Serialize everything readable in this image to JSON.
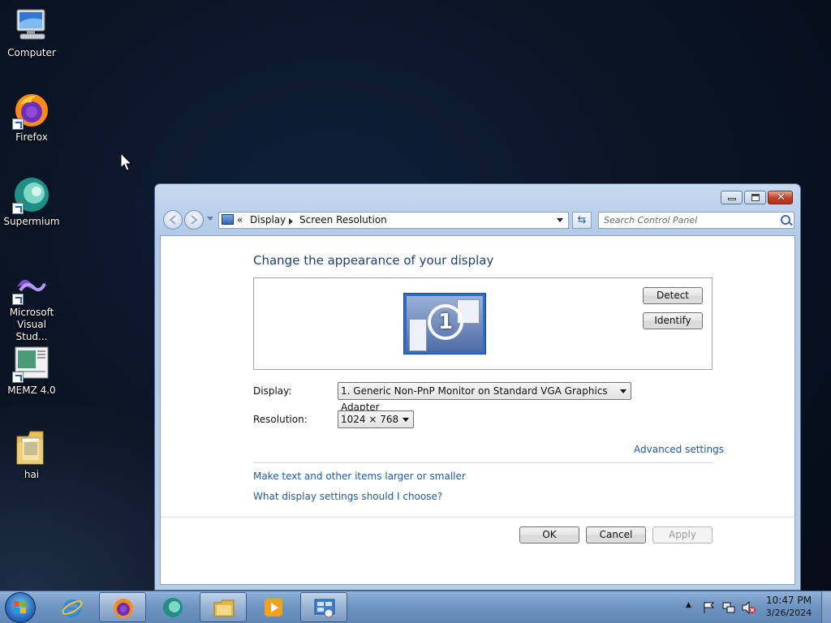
{
  "desktop": {
    "icons": [
      {
        "label": "Computer",
        "icon": "computer-icon"
      },
      {
        "label": "Firefox",
        "icon": "firefox-icon"
      },
      {
        "label": "Supermium",
        "icon": "supermium-icon"
      },
      {
        "label": "Microsoft Visual Stud...",
        "icon": "visual-studio-icon"
      },
      {
        "label": "MEMZ 4.0",
        "icon": "memz-icon"
      },
      {
        "label": "hai",
        "icon": "folder-icon"
      }
    ]
  },
  "window": {
    "breadcrumb": {
      "overflow": "«",
      "items": [
        "Display",
        "Screen Resolution"
      ]
    },
    "search_placeholder": "Search Control Panel",
    "page_title": "Change the appearance of your display",
    "monitor_number": "1",
    "detect_label": "Detect",
    "identify_label": "Identify",
    "display_label": "Display:",
    "display_value": "1. Generic Non-PnP Monitor on Standard VGA Graphics Adapter",
    "resolution_label": "Resolution:",
    "resolution_value": "1024 × 768",
    "advanced_link": "Advanced settings",
    "links": [
      "Make text and other items larger or smaller",
      "What display settings should I choose?"
    ],
    "ok_label": "OK",
    "cancel_label": "Cancel",
    "apply_label": "Apply"
  },
  "taskbar": {
    "pinned": [
      "internet-explorer-icon",
      "firefox-icon",
      "supermium-icon",
      "file-explorer-icon",
      "media-player-icon",
      "control-panel-icon"
    ],
    "clock_time": "10:47 PM",
    "clock_date": "3/26/2024"
  },
  "colors": {
    "accent_link": "#1e5aa8",
    "title_blue": "#1e3f7a",
    "taskbar": "#6f95c2"
  }
}
